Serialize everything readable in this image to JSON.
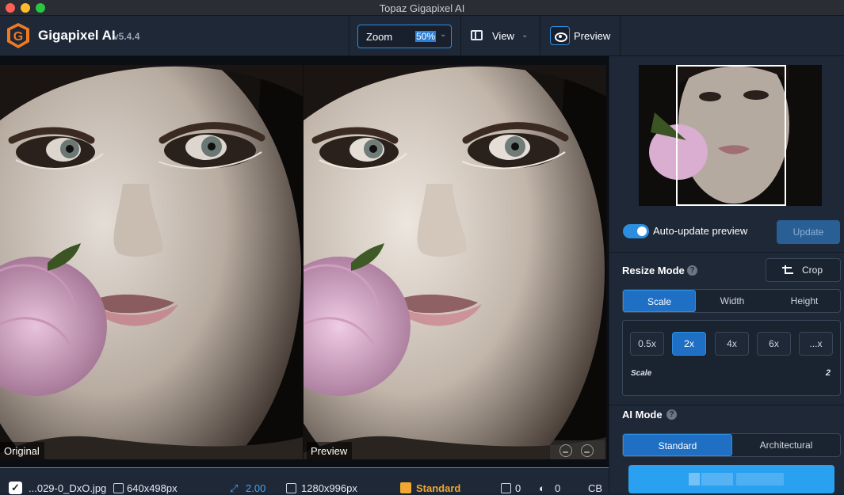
{
  "window": {
    "title": "Topaz Gigapixel AI"
  },
  "toolbar": {
    "app_name": "Gigapixel AI",
    "version": "v5.4.4",
    "zoom_label": "Zoom",
    "zoom_value": "50%",
    "view_label": "View",
    "preview_label": "Preview"
  },
  "canvas": {
    "original_label": "Original",
    "preview_label": "Preview"
  },
  "statusbar": {
    "filename": "...029-0_DxO.jpg",
    "input_size": "640x498px",
    "scale": "2.00",
    "output_size": "1280x996px",
    "ai_mode": "Standard",
    "noise": "0",
    "blur": "0",
    "extra": "CB"
  },
  "panel": {
    "auto_update_label": "Auto-update preview",
    "update_label": "Update",
    "resize_mode_title": "Resize Mode",
    "crop_label": "Crop",
    "resize_tabs": [
      "Scale",
      "Width",
      "Height"
    ],
    "scale_options": [
      "0.5x",
      "2x",
      "4x",
      "6x",
      "...x"
    ],
    "selected_scale": "2x",
    "scale_field_label": "Scale",
    "scale_field_value": "2",
    "ai_mode_title": "AI Mode",
    "ai_tabs": [
      "Standard",
      "Architectural"
    ]
  },
  "colors": {
    "accent": "#2d8ee0",
    "panel_bg": "#1e2836",
    "highlight_orange": "#f0a830"
  }
}
